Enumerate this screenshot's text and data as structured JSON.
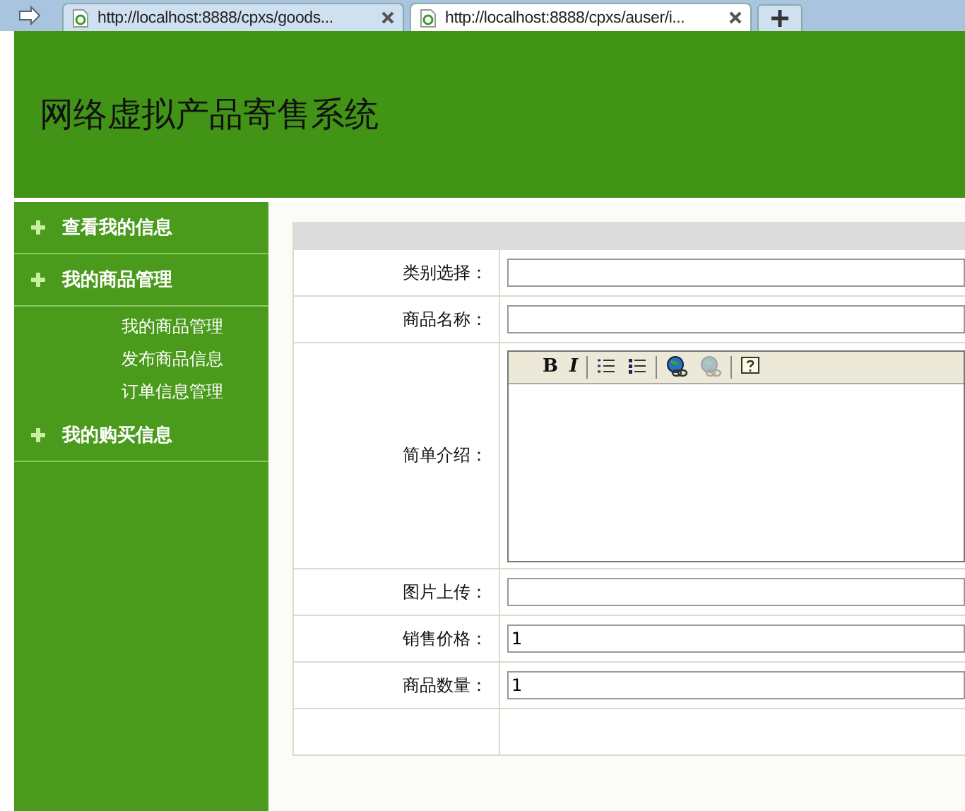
{
  "browser": {
    "tabs": [
      {
        "title": "http://localhost:8888/cpxs/goods...",
        "selected": false
      },
      {
        "title": "http://localhost:8888/cpxs/auser/i...",
        "selected": true
      }
    ]
  },
  "header": {
    "title": "网络虚拟产品寄售系统"
  },
  "sidebar": {
    "items": [
      {
        "label": "查看我的信息"
      },
      {
        "label": "我的商品管理",
        "children": [
          {
            "label": "我的商品管理"
          },
          {
            "label": "发布商品信息"
          },
          {
            "label": "订单信息管理"
          }
        ]
      },
      {
        "label": "我的购买信息"
      }
    ]
  },
  "form": {
    "rows": [
      {
        "kind": "input",
        "label": "类别选择："
      },
      {
        "kind": "input",
        "label": "商品名称："
      },
      {
        "kind": "editor",
        "label": "简单介绍：",
        "toolbar": [
          {
            "kind": "bold",
            "label": "B",
            "disabled": false
          },
          {
            "kind": "italic",
            "label": "I",
            "disabled": false
          },
          {
            "kind": "ordered-list",
            "disabled": false
          },
          {
            "kind": "bullet-list",
            "disabled": false
          },
          {
            "kind": "link",
            "disabled": false
          },
          {
            "kind": "unlink",
            "disabled": true
          },
          {
            "kind": "help",
            "disabled": false
          }
        ]
      },
      {
        "kind": "input",
        "label": "图片上传："
      },
      {
        "kind": "input",
        "label": "销售价格：",
        "value": "1"
      },
      {
        "kind": "input",
        "label": "商品数量：",
        "value": "1"
      },
      {
        "kind": "empty"
      }
    ]
  }
}
